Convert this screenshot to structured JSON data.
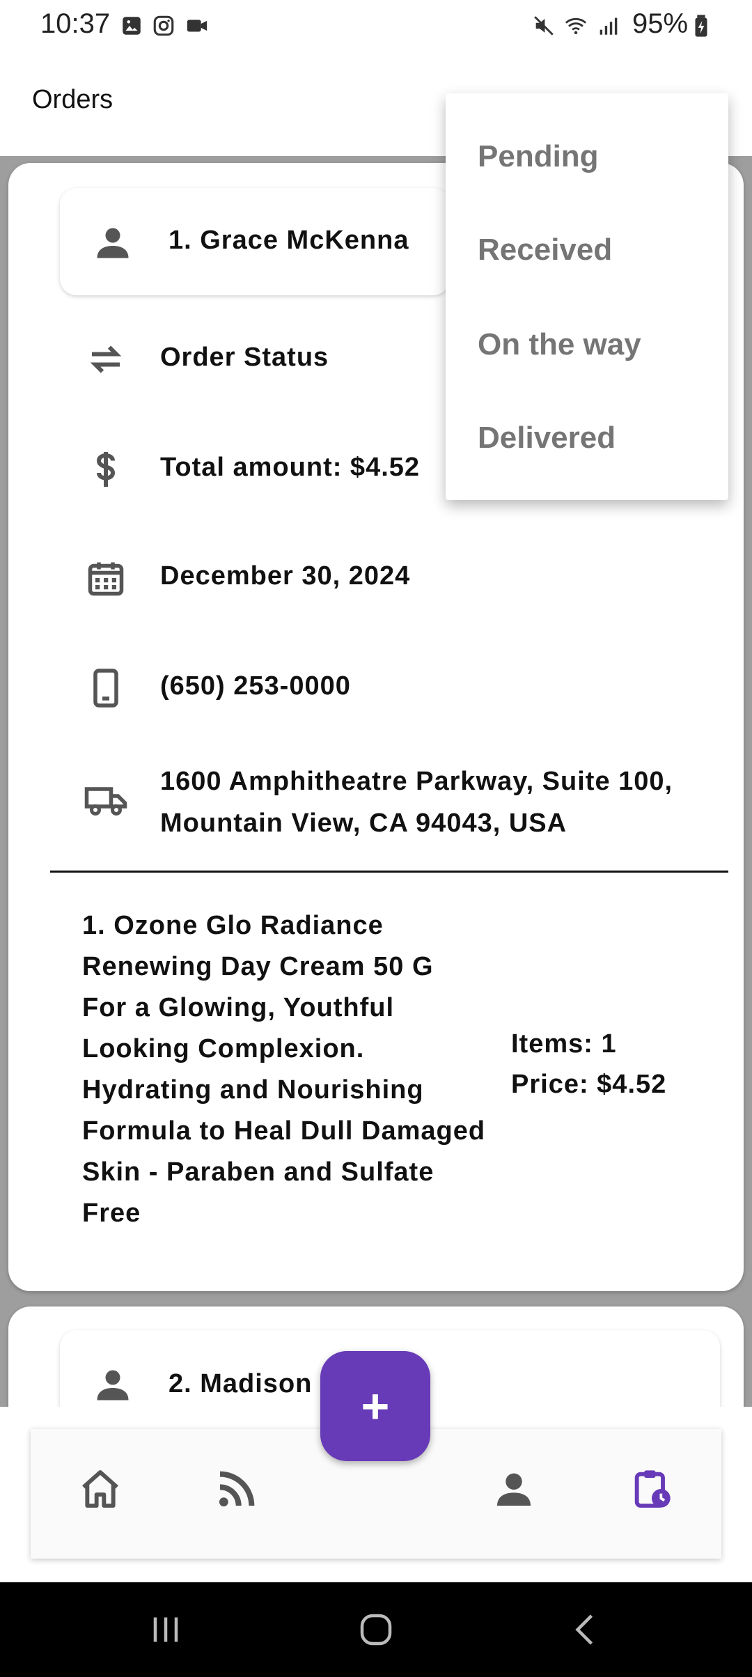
{
  "status_bar": {
    "time": "10:37",
    "battery": "95%",
    "left_icons": [
      "gallery-icon",
      "instagram-icon",
      "video-icon"
    ],
    "right_icons": [
      "mute-icon",
      "wifi-icon",
      "signal-icon",
      "battery-icon"
    ]
  },
  "app_bar": {
    "title": "Orders"
  },
  "orders": [
    {
      "customer": "1. Grace McKenna",
      "status_label": "Order Status",
      "total": "Total amount: $4.52",
      "date": "December 30, 2024",
      "phone": "(650) 253-0000",
      "address": "1600 Amphitheatre Parkway, Suite 100, Mountain View, CA 94043, USA",
      "product": {
        "name": "1. Ozone Glo Radiance Renewing Day Cream 50 G For a Glowing, Youthful Looking Complexion. Hydrating and Nourishing Formula to Heal Dull Damaged Skin - Paraben and Sulfate Free",
        "items": "Items: 1",
        "price": "Price: $4.52"
      }
    },
    {
      "customer": "2. Madison"
    }
  ],
  "status_menu": {
    "options": [
      "Pending",
      "Received",
      "On the way",
      "Delivered"
    ]
  },
  "fab": {
    "label": "+"
  },
  "bottom_nav": {
    "items": [
      "home-icon",
      "feed-icon",
      "profile-icon",
      "orders-icon"
    ],
    "active": "orders-icon",
    "accent": "#673ab7"
  },
  "colors": {
    "accent": "#673ab7",
    "list_background": "#9e9e9e",
    "menu_text": "#757575"
  }
}
